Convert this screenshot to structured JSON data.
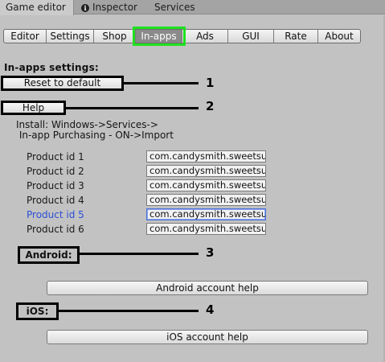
{
  "window_tabs": [
    {
      "label": "Game editor"
    },
    {
      "label": "Inspector",
      "icon": "info-icon"
    },
    {
      "label": "Services"
    }
  ],
  "toolbar": {
    "active": "In-apps",
    "highlight_color": "#1fe01f",
    "items": [
      "Editor",
      "Settings",
      "Shop",
      "In-apps",
      "Ads",
      "GUI",
      "Rate",
      "About"
    ]
  },
  "inapps": {
    "section_title": "In-apps settings:",
    "reset_button": "Reset to default",
    "help_button": "Help",
    "install_text": "Install: Windows->Services->\n In-app Purchasing - ON->Import",
    "products": [
      {
        "label": "Product id 1",
        "value": "com.candysmith.sweetsu"
      },
      {
        "label": "Product id 2",
        "value": "com.candysmith.sweetsu"
      },
      {
        "label": "Product id 3",
        "value": "com.candysmith.sweetsu"
      },
      {
        "label": "Product id 4",
        "value": "com.candysmith.sweetsu"
      },
      {
        "label": "Product id 5",
        "value": "com.candysmith.sweetsu",
        "focused": true
      },
      {
        "label": "Product id 6",
        "value": "com.candysmith.sweetsu"
      }
    ],
    "android_label": "Android:",
    "android_help_button": "Android account help",
    "ios_label": "iOS:",
    "ios_help_button": "iOS account help"
  },
  "callouts": [
    "1",
    "2",
    "3",
    "4"
  ]
}
